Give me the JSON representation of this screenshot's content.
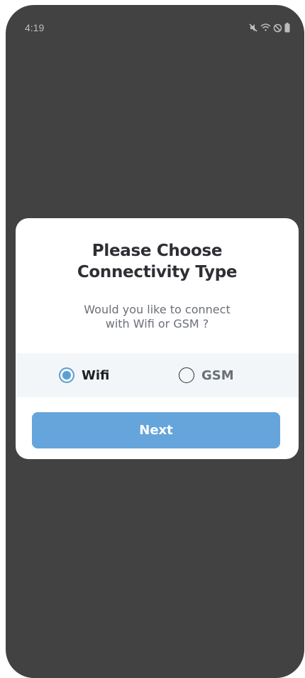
{
  "status_bar": {
    "time": "4:19",
    "icons": [
      "mute-icon",
      "wifi-icon",
      "do-not-disturb-icon",
      "battery-icon"
    ]
  },
  "dialog": {
    "title": "Please Choose\nConnectivity Type",
    "subtitle": "Would you like to connect\nwith Wifi or GSM ?",
    "options": [
      {
        "label": "Wifi",
        "selected": true
      },
      {
        "label": "GSM",
        "selected": false
      }
    ],
    "next_label": "Next"
  },
  "colors": {
    "backdrop": "#424242",
    "accent": "#5a9fd4",
    "button": "#65a5db",
    "options_band": "#f3f6f8"
  }
}
